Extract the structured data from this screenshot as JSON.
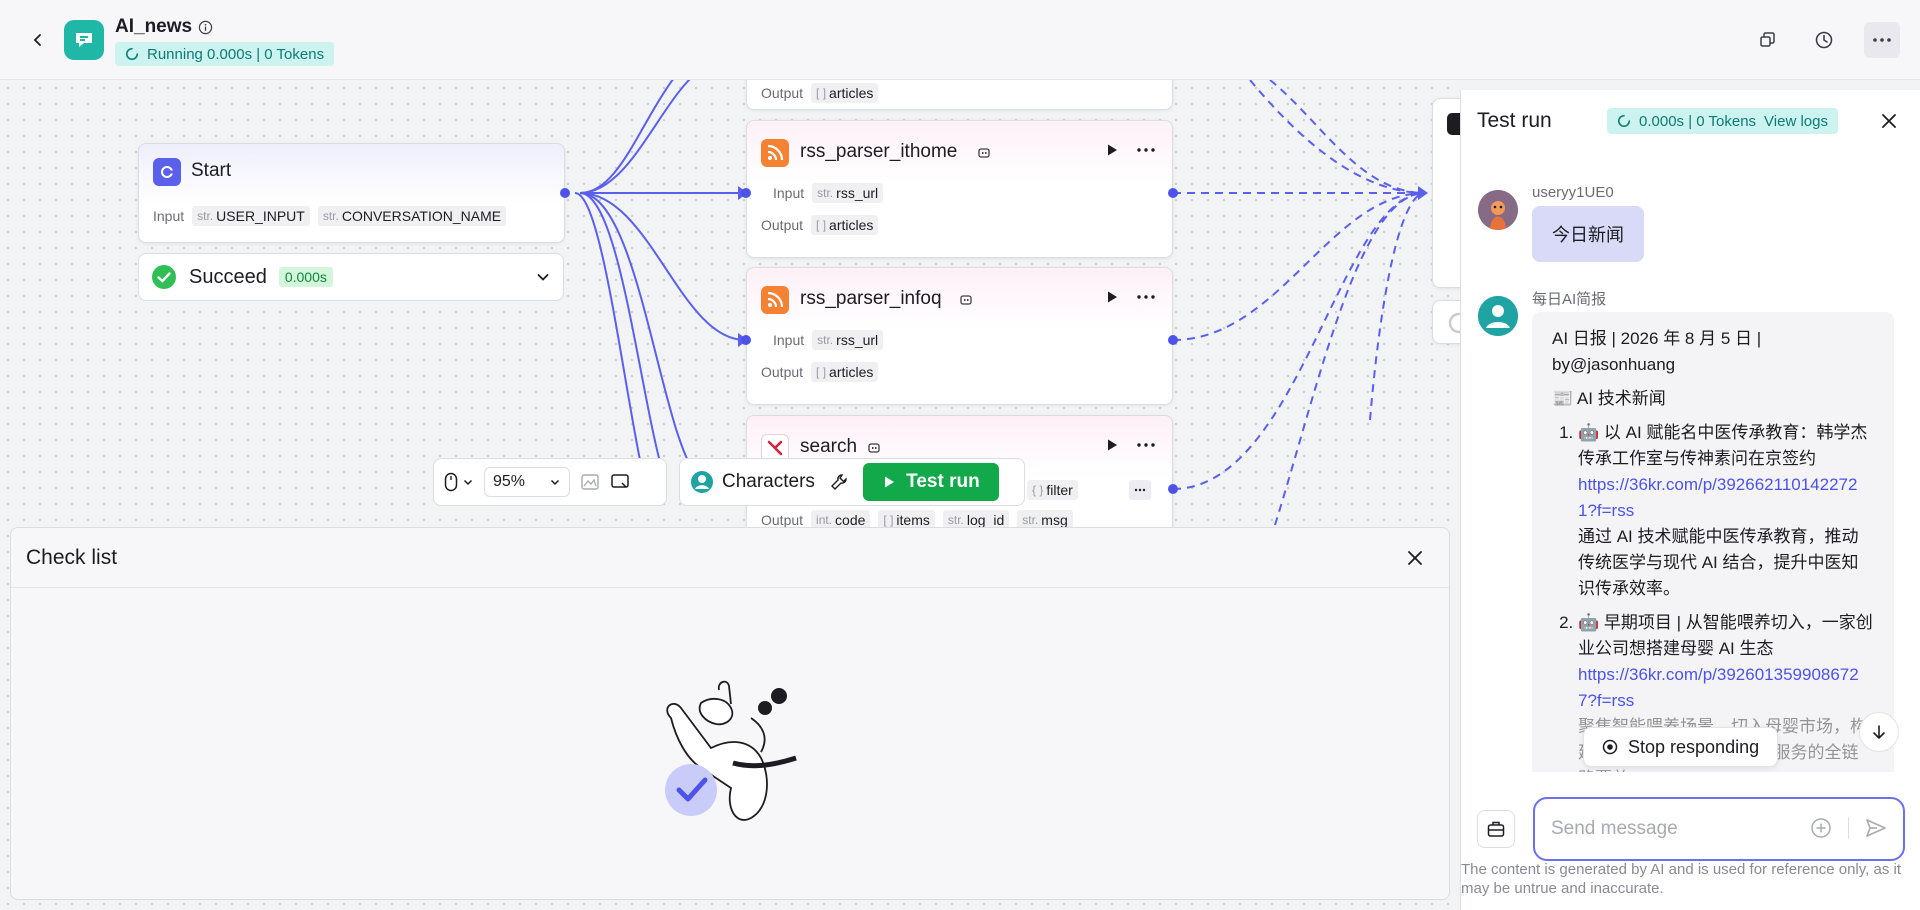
{
  "header": {
    "app_name": "AI_news",
    "run_status": "Running 0.000s | 0 Tokens"
  },
  "nodes": {
    "top_partial": {
      "output_label": "Output",
      "output_tag_type": "[ ]",
      "output_tag_name": "articles"
    },
    "start": {
      "title": "Start",
      "input_label": "Input",
      "tag1_type": "str.",
      "tag1_name": "USER_INPUT",
      "tag2_type": "str.",
      "tag2_name": "CONVERSATION_NAME"
    },
    "succeed": {
      "label": "Succeed",
      "time": "0.000s"
    },
    "rss_ithome": {
      "title": "rss_parser_ithome",
      "input_label": "Input",
      "input_type": "str.",
      "input_name": "rss_url",
      "output_label": "Output",
      "output_type": "[ ]",
      "output_name": "articles"
    },
    "rss_infoq": {
      "title": "rss_parser_infoq",
      "input_label": "Input",
      "input_type": "str.",
      "input_name": "rss_url",
      "output_label": "Output",
      "output_type": "[ ]",
      "output_name": "articles"
    },
    "search": {
      "title": "search",
      "filter_type": "{ }",
      "filter_name": "filter",
      "output_label": "Output",
      "out1_type": "int.",
      "out1_name": "code",
      "out2_type": "[ ]",
      "out2_name": "items",
      "out3_type": "str.",
      "out3_name": "log_id",
      "out4_type": "str.",
      "out4_name": "msg"
    }
  },
  "toolbar": {
    "zoom": "95%",
    "characters_label": "Characters",
    "test_run_label": "Test run"
  },
  "checklist": {
    "title": "Check list"
  },
  "panel": {
    "title": "Test run",
    "badge_status": "0.000s | 0 Tokens",
    "view_logs": "View logs",
    "user_name": "useryy1UE0",
    "user_message": "今日新闻",
    "bot_name": "每日AI简报",
    "bot_header": "AI 日报 | 2026 年 8 月 5 日 | by@jasonhuang",
    "bot_section": "📰 AI 技术新闻",
    "items": [
      {
        "title": "🤖 以 AI 赋能名中医传承教育：韩学杰传承工作室与传神素问在京签约",
        "link": "https://36kr.com/p/3926621101422721?f=rss",
        "summary": "通过 AI 技术赋能中医传承教育，推动传统医学与现代 AI 结合，提升中医知识传承效率。"
      },
      {
        "title": "🤖 早期项目 | 从智能喂养切入，一家创业公司想搭建母婴 AI 生态",
        "link": "https://36kr.com/p/3926013599086727?f=rss",
        "summary": "聚焦智能喂养场景，切入母婴市场，构建母婴 AI 生态，从产品到服务的全链路覆盖。"
      }
    ],
    "stop_label": "Stop responding",
    "composer_placeholder": "Send message",
    "disclaimer": "The content is generated by AI and is used for reference only, as it may be untrue and inaccurate."
  }
}
